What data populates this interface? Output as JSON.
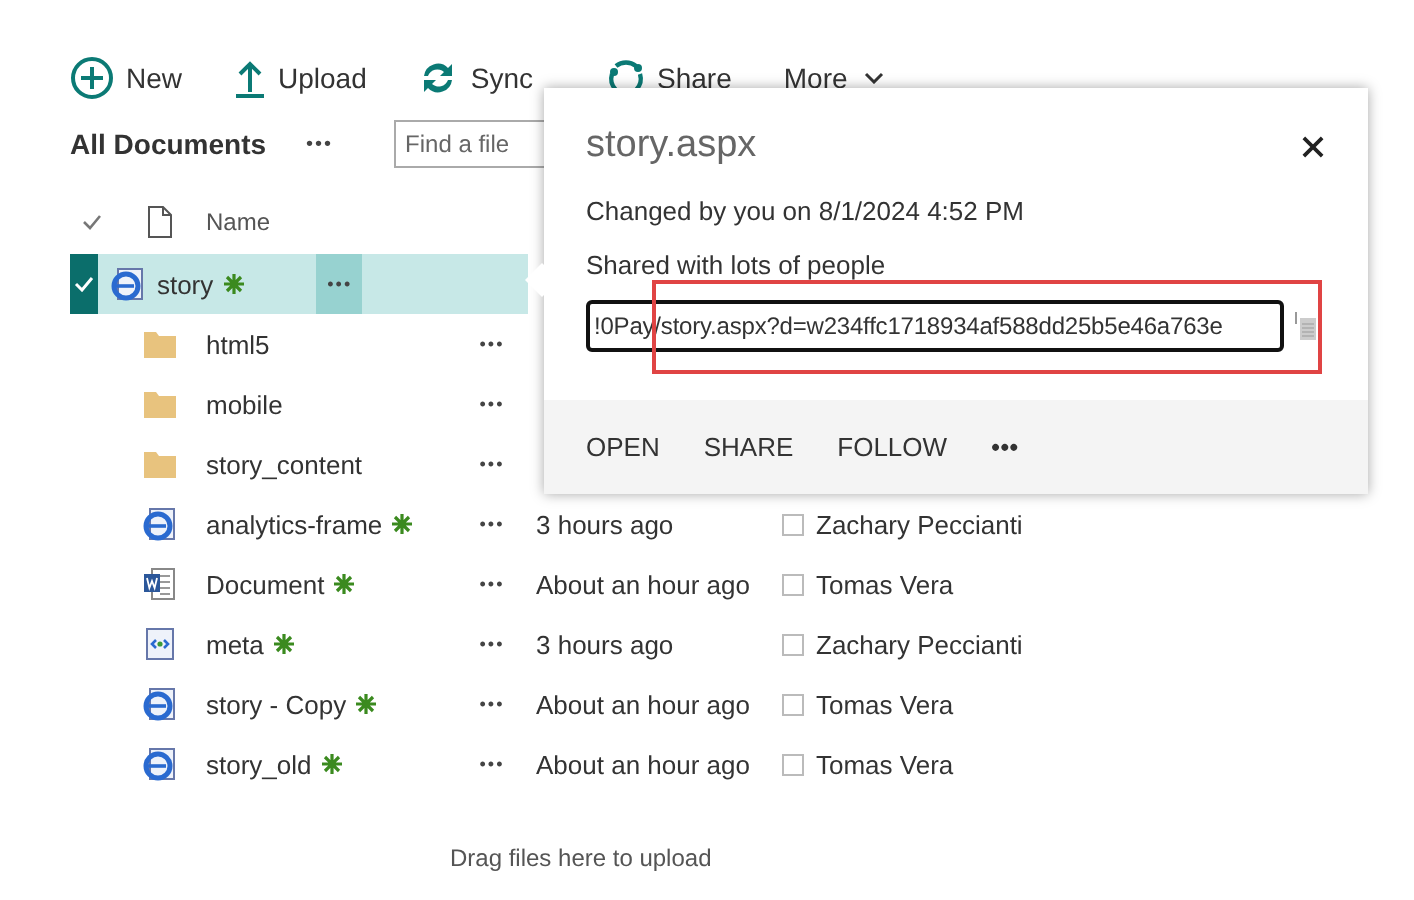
{
  "toolbar": [
    {
      "kind": "new",
      "label": "New"
    },
    {
      "kind": "upload",
      "label": "Upload"
    },
    {
      "kind": "sync",
      "label": "Sync"
    },
    {
      "kind": "share",
      "label": "Share"
    },
    {
      "kind": "more",
      "label": "More"
    }
  ],
  "view": {
    "title": "All Documents",
    "more": "•••",
    "search": {
      "placeholder": "Find a file"
    }
  },
  "columns": {
    "name": "Name"
  },
  "rows": [
    {
      "kind": "web",
      "name": "story",
      "new": true,
      "selected": true,
      "more": "•••"
    },
    {
      "kind": "folder",
      "name": "html5",
      "new": false,
      "selected": false,
      "more": "•••"
    },
    {
      "kind": "folder",
      "name": "mobile",
      "new": false,
      "selected": false,
      "more": "•••"
    },
    {
      "kind": "folder",
      "name": "story_content",
      "new": false,
      "selected": false,
      "more": "•••"
    },
    {
      "kind": "web",
      "name": "analytics-frame",
      "new": true,
      "selected": false,
      "more": "•••",
      "modified": "3 hours ago",
      "modified_by": "Zachary Peccianti"
    },
    {
      "kind": "word",
      "name": "Document",
      "new": true,
      "selected": false,
      "more": "•••",
      "modified": "About an hour ago",
      "modified_by": "Tomas Vera"
    },
    {
      "kind": "code",
      "name": "meta",
      "new": true,
      "selected": false,
      "more": "•••",
      "modified": "3 hours ago",
      "modified_by": "Zachary Peccianti"
    },
    {
      "kind": "web",
      "name": "story - Copy",
      "new": true,
      "selected": false,
      "more": "•••",
      "modified": "About an hour ago",
      "modified_by": "Tomas Vera"
    },
    {
      "kind": "web",
      "name": "story_old",
      "new": true,
      "selected": false,
      "more": "•••",
      "modified": "About an hour ago",
      "modified_by": "Tomas Vera"
    }
  ],
  "drop_hint": "Drag files here to upload",
  "callout": {
    "title": "story.aspx",
    "changed": "Changed by you on 8/1/2024 4:52 PM",
    "shared": "Shared with lots of people",
    "link": "!0Pay/story.aspx?d=w234ffc1718934af588dd25b5e46a763e",
    "actions": [
      "OPEN",
      "SHARE",
      "FOLLOW",
      "•••"
    ]
  }
}
